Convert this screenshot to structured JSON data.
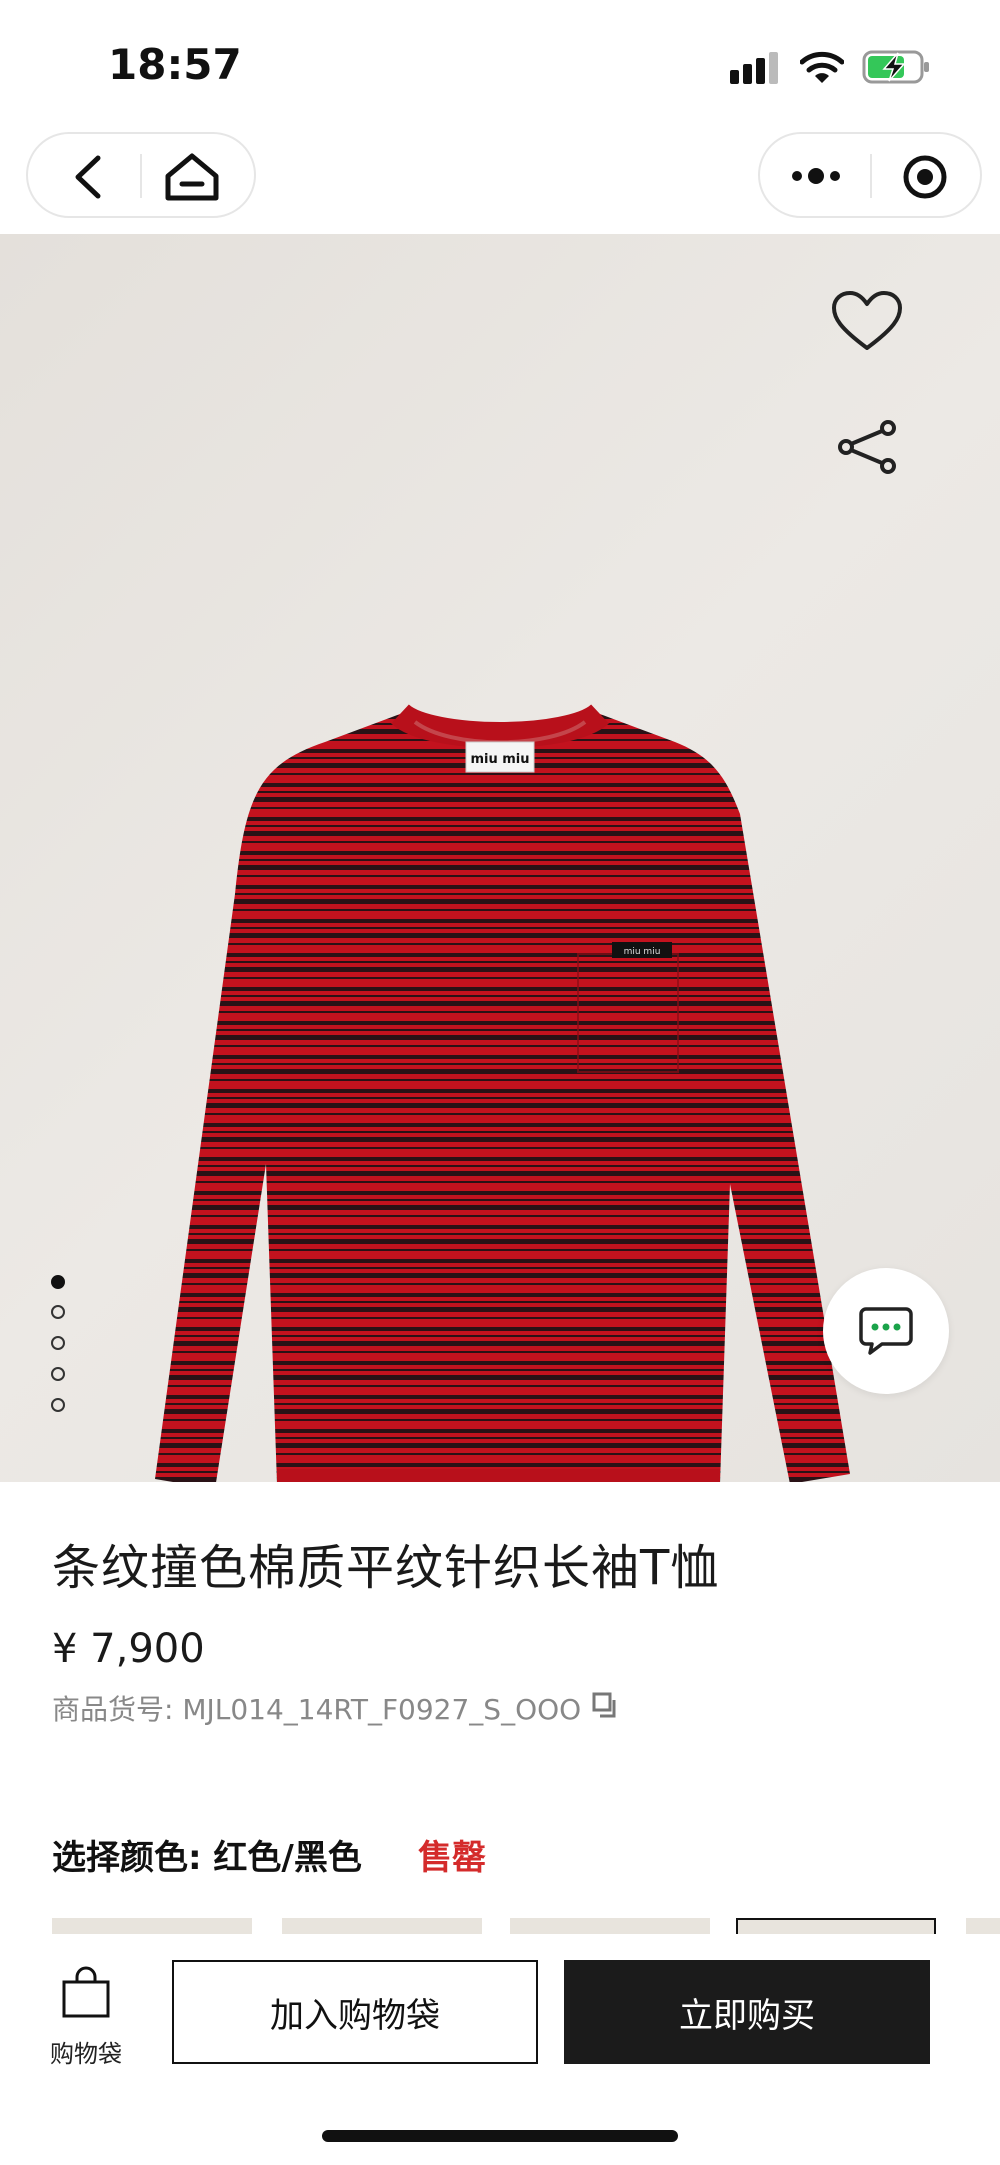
{
  "status_bar": {
    "time": "18:57"
  },
  "product": {
    "title": "条纹撞色棉质平纹针织长袖T恤",
    "price": "¥ 7,900",
    "sku": "商品货号: MJL014_14RT_F0927_S_OOO",
    "color_label": "选择颜色: 红色/黑色",
    "stock_status": "售罄"
  },
  "gallery": {
    "image_count": 5,
    "active_index": 0,
    "garment_label": "miu miu"
  },
  "bottom_bar": {
    "bag_label": "购物袋",
    "add_to_bag": "加入购物袋",
    "buy_now": "立即购买"
  },
  "colors": {
    "sold_out": "#d42b2b",
    "primary_button": "#1b1b1b",
    "shirt_red": "#c3121e",
    "shirt_stripe": "#2a1216"
  }
}
